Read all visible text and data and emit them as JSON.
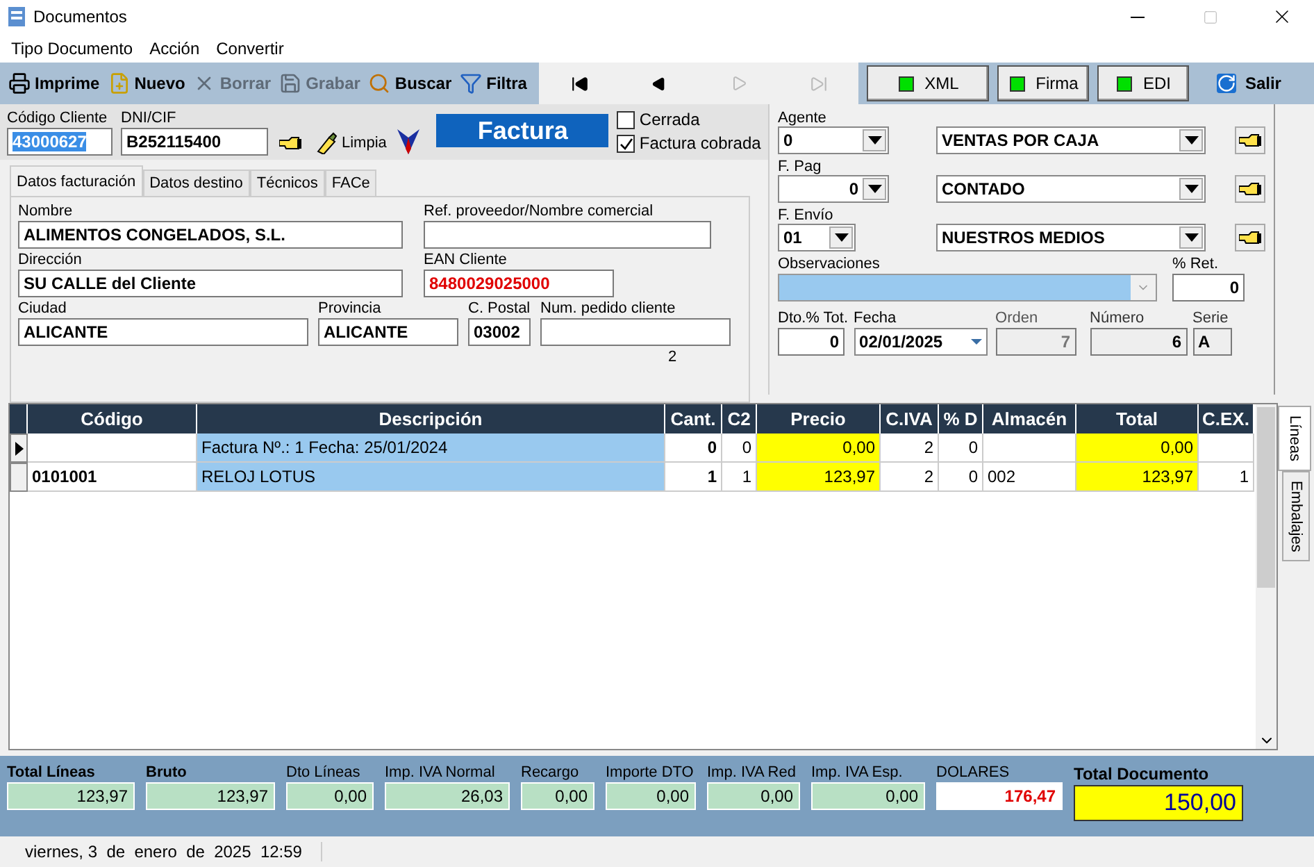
{
  "window": {
    "title": "Documentos"
  },
  "menu": [
    "Tipo Documento",
    "Acción",
    "Convertir"
  ],
  "toolbar": [
    {
      "label": "Imprime",
      "kind": "print",
      "disabled": false
    },
    {
      "label": "Nuevo",
      "kind": "new",
      "disabled": false
    },
    {
      "label": "Borrar",
      "kind": "delete",
      "disabled": true
    },
    {
      "label": "Grabar",
      "kind": "save",
      "disabled": true
    },
    {
      "label": "Buscar",
      "kind": "search",
      "disabled": false
    },
    {
      "label": "Filtra",
      "kind": "filter",
      "disabled": false
    }
  ],
  "navigation": [
    {
      "kind": "first",
      "disabled": false
    },
    {
      "kind": "prev",
      "disabled": false
    },
    {
      "kind": "next",
      "disabled": true
    },
    {
      "kind": "last",
      "disabled": true
    }
  ],
  "status_buttons": [
    {
      "label": "XML",
      "color": "#00e000"
    },
    {
      "label": "Firma",
      "color": "#00e000"
    },
    {
      "label": "EDI",
      "color": "#00e000"
    }
  ],
  "exit_button": "Salir",
  "header": {
    "client_code_label": "Código Cliente",
    "client_code": "43000627",
    "dni_label": "DNI/CIF",
    "dni": "B252115400",
    "clear_label": "Limpia",
    "doc_type": "Factura",
    "checks": [
      {
        "label": "Cerrada",
        "checked": false
      },
      {
        "label": "Factura cobrada",
        "checked": true
      }
    ]
  },
  "tabs": [
    {
      "label": "Datos facturación",
      "selected": true
    },
    {
      "label": "Datos destino",
      "selected": false
    },
    {
      "label": "Técnicos",
      "selected": false
    },
    {
      "label": "FACe",
      "selected": false
    }
  ],
  "billing": {
    "name_label": "Nombre",
    "name": "ALIMENTOS CONGELADOS, S.L.",
    "ref_label": "Ref. proveedor/Nombre comercial",
    "address_label": "Dirección",
    "address": "SU CALLE del Cliente",
    "ean_label": "EAN Cliente",
    "ean": "8480029025000",
    "city_label": "Ciudad",
    "city": "ALICANTE",
    "province_label": "Provincia",
    "province": "ALICANTE",
    "postal_label": "C. Postal",
    "postal": "03002",
    "order_label": "Num. pedido cliente",
    "counter": "2"
  },
  "side": {
    "agent_label": "Agente",
    "agent_code": "0",
    "agent_name": "VENTAS POR CAJA",
    "pay_label": "F. Pag",
    "pay_code": "0",
    "pay_name": "CONTADO",
    "ship_label": "F. Envío",
    "ship_code": "01",
    "ship_name": "NUESTROS MEDIOS",
    "notes_label": "Observaciones",
    "ret_label": "% Ret.",
    "ret": "0",
    "discount_label": "Dto.% Tot.",
    "discount": "0",
    "date_label": "Fecha",
    "date": "02/01/2025",
    "order_label": "Orden",
    "order": "7",
    "number_label": "Número",
    "number": "6",
    "series_label": "Serie",
    "series": "A"
  },
  "table": {
    "columns": [
      "Código",
      "Descripción",
      "Cant.",
      "C2",
      "Precio",
      "C.IVA",
      "% D",
      "Almacén",
      "Total",
      "C.EX."
    ],
    "rows": [
      {
        "selected": true,
        "cells": [
          "",
          "Factura Nº.: 1 Fecha: 25/01/2024",
          "0",
          "0",
          "0,00",
          "2",
          "0",
          "",
          "0,00",
          ""
        ]
      },
      {
        "selected": false,
        "cells": [
          "0101001",
          "RELOJ LOTUS",
          "1",
          "1",
          "123,97",
          "2",
          "0",
          "002",
          "123,97",
          "1"
        ]
      }
    ]
  },
  "side_tabs": [
    {
      "label": "Líneas",
      "selected": true
    },
    {
      "label": "Embalajes",
      "selected": false
    }
  ],
  "totals": [
    {
      "label": "Total Líneas",
      "value": "123,97",
      "kind": "bold"
    },
    {
      "label": "Bruto",
      "value": "123,97",
      "kind": "bold"
    },
    {
      "label": "Dto Líneas",
      "value": "0,00",
      "kind": "normal"
    },
    {
      "label": "Imp. IVA Normal",
      "value": "26,03",
      "kind": "normal"
    },
    {
      "label": "Recargo",
      "value": "0,00",
      "kind": "normal"
    },
    {
      "label": "Importe DTO",
      "value": "0,00",
      "kind": "normal"
    },
    {
      "label": "Imp. IVA Red",
      "value": "0,00",
      "kind": "normal"
    },
    {
      "label": "Imp. IVA Esp.",
      "value": "0,00",
      "kind": "normal"
    },
    {
      "label": "DOLARES",
      "value": "176,47",
      "kind": "currency"
    },
    {
      "label": "Total Documento",
      "value": "150,00",
      "kind": "grand"
    }
  ],
  "status_bar": "viernes, 3  de  enero  de  2025  12:59"
}
